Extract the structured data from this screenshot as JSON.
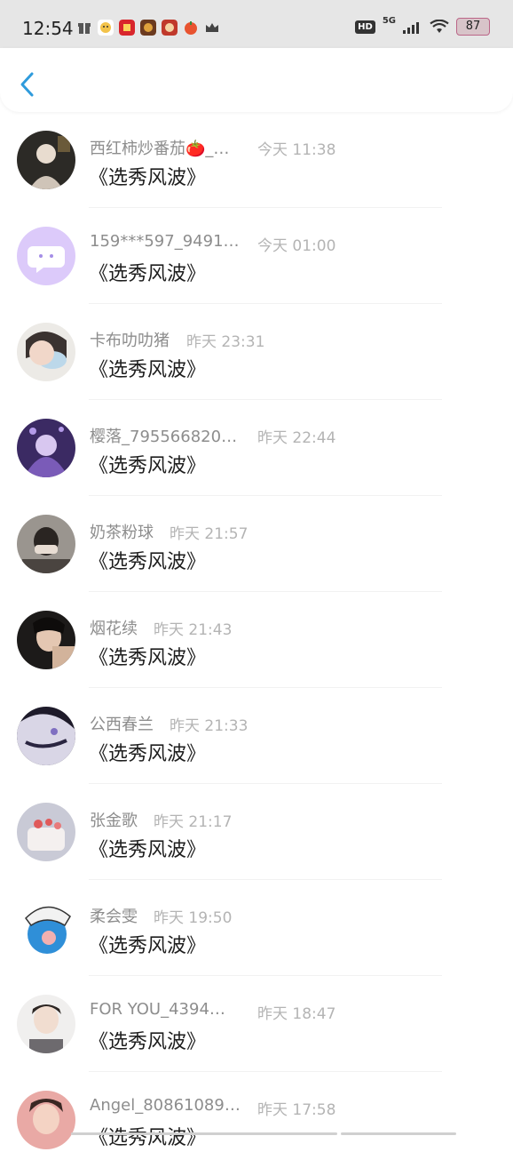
{
  "status_bar": {
    "time": "12:54",
    "battery": "87",
    "network_badge": "HD",
    "network_type": "5G",
    "icons": [
      "gift-icon",
      "face-app-icon",
      "red-app-icon",
      "game-app-icon",
      "game2-app-icon",
      "tomato-app-icon",
      "crown-icon",
      "wifi-icon",
      "signal-icon"
    ]
  },
  "header": {
    "back_icon": "chevron-left-icon",
    "accent": "#2f9bdc"
  },
  "comments": [
    {
      "name": "西红柿炒番茄🍅_…",
      "time": "今天 11:38",
      "message": "《选秀风波》"
    },
    {
      "name": "159***597_9491…",
      "time": "今天 01:00",
      "message": "《选秀风波》"
    },
    {
      "name": "卡布叻叻猪",
      "time": "昨天 23:31",
      "message": "《选秀风波》"
    },
    {
      "name": "樱落_795566820…",
      "time": "昨天 22:44",
      "message": "《选秀风波》"
    },
    {
      "name": "奶茶粉球",
      "time": "昨天 21:57",
      "message": "《选秀风波》"
    },
    {
      "name": "烟花续",
      "time": "昨天 21:43",
      "message": "《选秀风波》"
    },
    {
      "name": "公西春兰",
      "time": "昨天 21:33",
      "message": "《选秀风波》"
    },
    {
      "name": "张金歌",
      "time": "昨天 21:17",
      "message": "《选秀风波》"
    },
    {
      "name": "柔会雯",
      "time": "昨天 19:50",
      "message": "《选秀风波》"
    },
    {
      "name": "FOR YOU_4394…",
      "time": "昨天 18:47",
      "message": "《选秀风波》"
    },
    {
      "name": "Angel_80861089…",
      "time": "昨天 17:58",
      "message": "《选秀风波》"
    }
  ]
}
